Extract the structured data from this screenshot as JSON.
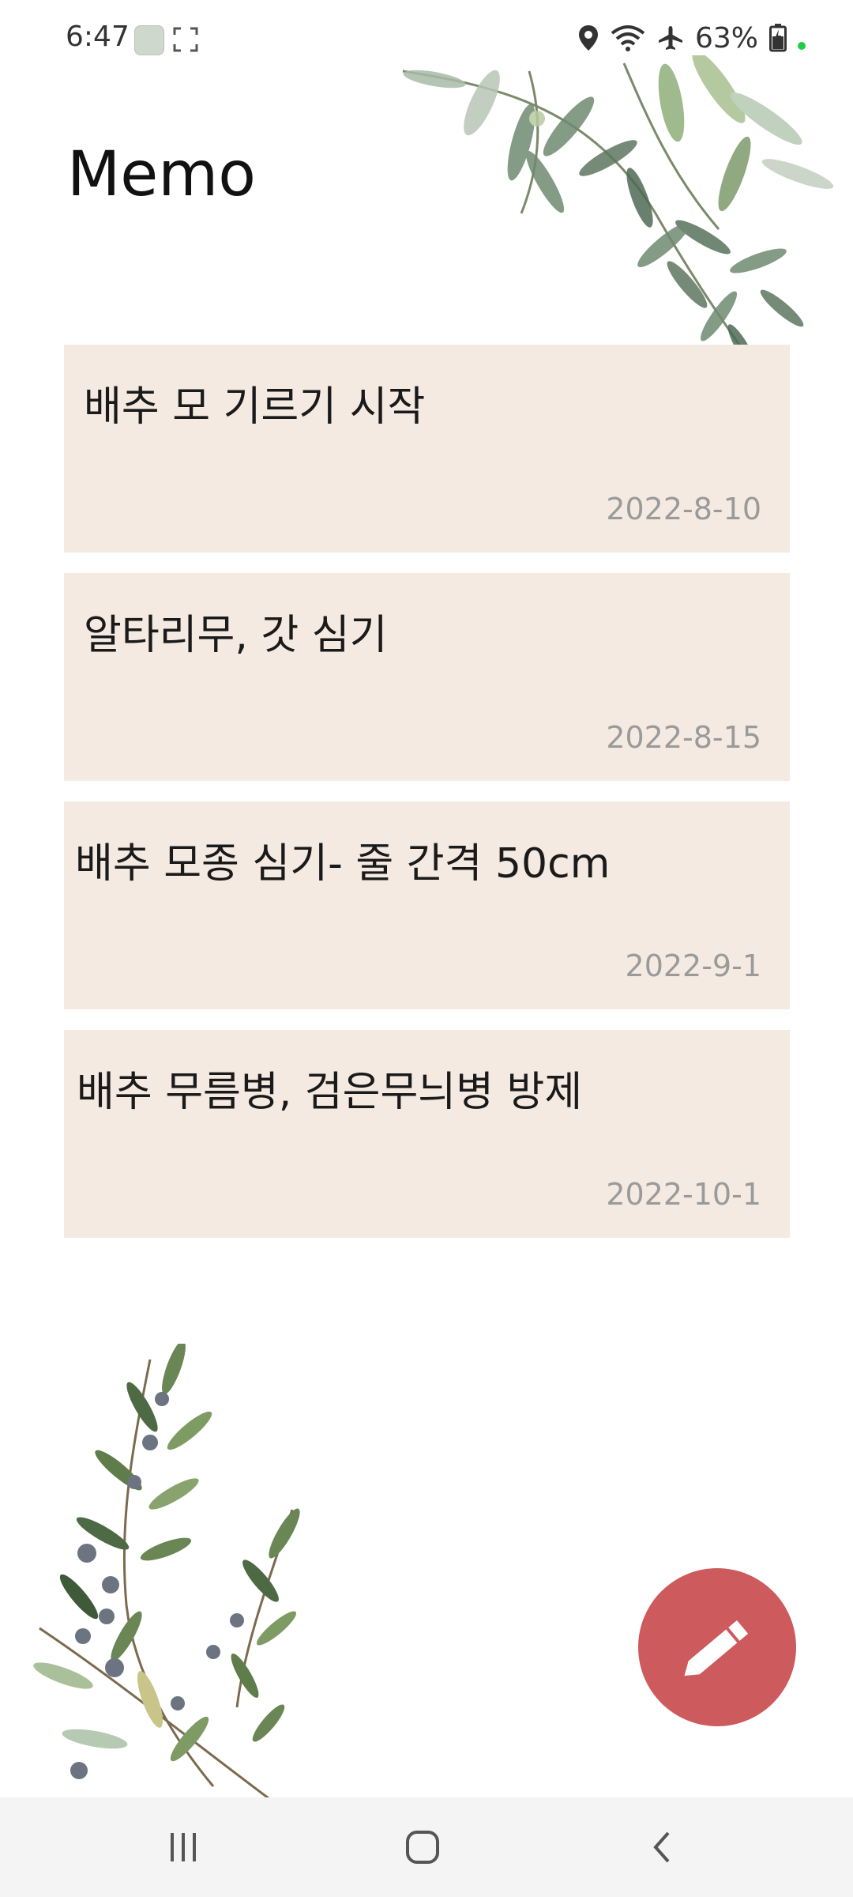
{
  "status_bar": {
    "time": "6:47",
    "battery": "63%",
    "icons": [
      "app-notification-icon",
      "screenshot-icon",
      "location-icon",
      "wifi-icon",
      "airplane-icon",
      "battery-icon"
    ]
  },
  "page": {
    "title": "Memo"
  },
  "memos": [
    {
      "title": "배추 모 기르기 시작",
      "date": "2022-8-10"
    },
    {
      "title": "알타리무, 갓 심기",
      "date": "2022-8-15"
    },
    {
      "title": "배추 모종 심기- 줄 간격 50cm",
      "date": "2022-9-1"
    },
    {
      "title": "배추 무름병, 검은무늬병 방제",
      "date": "2022-10-1"
    }
  ],
  "fab": {
    "icon": "pencil-icon",
    "color": "#cd5a5c"
  },
  "nav_bar": {
    "icons": [
      "recent-apps-icon",
      "home-icon",
      "back-icon"
    ]
  },
  "colors": {
    "card_background": "#f4eae1",
    "date_text": "#9a9a9a"
  }
}
